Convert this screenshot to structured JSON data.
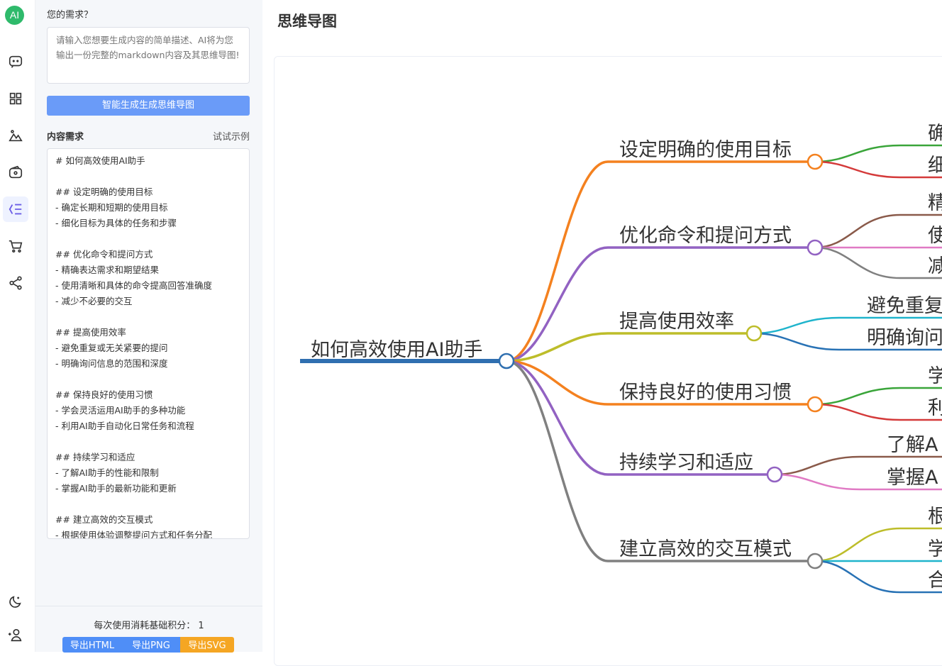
{
  "sidebar": {
    "logo_text": "AI",
    "icons": [
      "chat-icon",
      "grid-icon",
      "image-icon",
      "wallet-icon",
      "mindmap-icon",
      "cart-icon",
      "share-icon",
      "dark-mode-icon",
      "user-add-icon"
    ],
    "active_color": "#6b5de6"
  },
  "form": {
    "question_label": "您的需求？",
    "description_placeholder": "请输入您想要生成内容的简单描述、AI将为您输出一份完整的markdown内容及其思维导图!",
    "generate_button": "智能生成生成思维导图",
    "content_label": "内容需求",
    "example_link": "试试示例",
    "markdown_lines": [
      "# 如何高效使用AI助手",
      "",
      "## 设定明确的使用目标",
      "- 确定长期和短期的使用目标",
      "- 细化目标为具体的任务和步骤",
      "",
      "## 优化命令和提问方式",
      "- 精确表达需求和期望结果",
      "- 使用清晰和具体的命令提高回答准确度",
      "- 减少不必要的交互",
      "",
      "## 提高使用效率",
      "- 避免重复或无关紧要的提问",
      "- 明确询问信息的范围和深度",
      "",
      "## 保持良好的使用习惯",
      "- 学会灵活运用AI助手的多种功能",
      "- 利用AI助手自动化日常任务和流程",
      "",
      "## 持续学习和适应",
      "- 了解AI助手的性能和限制",
      "- 掌握AI助手的最新功能和更新",
      "",
      "## 建立高效的交互模式",
      "- 根据使用体验调整提问方式和任务分配"
    ]
  },
  "footer": {
    "cost_text": "每次使用消耗基础积分： 1",
    "export_html": "导出HTML",
    "export_png": "导出PNG",
    "export_svg": "导出SVG"
  },
  "main": {
    "title": "思维导图"
  },
  "mindmap": {
    "root": "如何高效使用AI助手",
    "root_color": "#2f6fb0",
    "branches": [
      {
        "label": "设定明确的使用目标",
        "color": "#f4811f",
        "children": [
          {
            "label": "确",
            "color": "#3aa53a"
          },
          {
            "label": "细",
            "color": "#d43a3a"
          }
        ]
      },
      {
        "label": "优化命令和提问方式",
        "color": "#9262c2",
        "children": [
          {
            "label": "精",
            "color": "#8a5a4a"
          },
          {
            "label": "使",
            "color": "#e07ac4"
          },
          {
            "label": "减",
            "color": "#808080"
          }
        ]
      },
      {
        "label": "提高使用效率",
        "color": "#bdbd2a",
        "children": [
          {
            "label": "避免重复",
            "color": "#1fb4cc"
          },
          {
            "label": "明确询问",
            "color": "#2872b5"
          }
        ]
      },
      {
        "label": "保持良好的使用习惯",
        "color": "#f4811f",
        "children": [
          {
            "label": "学",
            "color": "#3aa53a"
          },
          {
            "label": "利",
            "color": "#d43a3a"
          }
        ]
      },
      {
        "label": "持续学习和适应",
        "color": "#9262c2",
        "children": [
          {
            "label": "了解A",
            "color": "#8a5a4a"
          },
          {
            "label": "掌握A",
            "color": "#e07ac4"
          }
        ]
      },
      {
        "label": "建立高效的交互模式",
        "color": "#808080",
        "children": [
          {
            "label": "根",
            "color": "#bdbd2a"
          },
          {
            "label": "学",
            "color": "#1fb4cc"
          },
          {
            "label": "合",
            "color": "#2872b5"
          }
        ]
      }
    ]
  }
}
